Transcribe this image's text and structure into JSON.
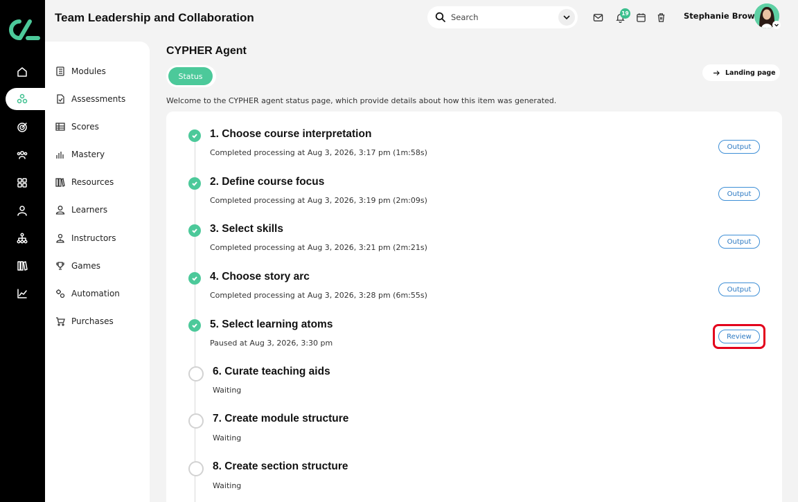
{
  "header": {
    "title": "Team Leadership and Collaboration",
    "search_placeholder": "Search",
    "notification_count": "19",
    "user_name": "Stephanie Brown"
  },
  "rail": {
    "icons": [
      "home-icon",
      "network-icon",
      "target-icon",
      "users-icon",
      "grid-icon",
      "person-icon",
      "org-chart-icon",
      "library-icon",
      "chart-line-icon"
    ]
  },
  "sidebar": {
    "items": [
      {
        "label": "Modules",
        "icon": "modules-icon"
      },
      {
        "label": "Assessments",
        "icon": "assessment-icon"
      },
      {
        "label": "Scores",
        "icon": "table-icon"
      },
      {
        "label": "Mastery",
        "icon": "bar-chart-icon"
      },
      {
        "label": "Resources",
        "icon": "books-icon"
      },
      {
        "label": "Learners",
        "icon": "user-icon"
      },
      {
        "label": "Instructors",
        "icon": "instructor-icon"
      },
      {
        "label": "Games",
        "icon": "trophy-icon"
      },
      {
        "label": "Automation",
        "icon": "gears-icon"
      },
      {
        "label": "Purchases",
        "icon": "cart-icon"
      }
    ]
  },
  "page": {
    "title": "CYPHER Agent",
    "tab_status": "Status",
    "landing_button": "Landing page",
    "welcome": "Welcome to the CYPHER agent status page, which provide details about how this item was generated."
  },
  "steps": [
    {
      "title": "1. Choose course interpretation",
      "status": "Completed processing at Aug 3, 2026, 3:17 pm (1m:58s)",
      "state": "done",
      "action": "Output"
    },
    {
      "title": "2. Define course focus",
      "status": "Completed processing at Aug 3, 2026, 3:19 pm (2m:09s)",
      "state": "done",
      "action": "Output"
    },
    {
      "title": "3. Select skills",
      "status": "Completed processing at Aug 3, 2026, 3:21 pm (2m:21s)",
      "state": "done",
      "action": "Output"
    },
    {
      "title": "4. Choose story arc",
      "status": "Completed processing at Aug 3, 2026, 3:28 pm (6m:55s)",
      "state": "done",
      "action": "Output"
    },
    {
      "title": "5. Select learning atoms",
      "status": "Paused at Aug 3, 2026, 3:30 pm",
      "state": "paused",
      "action": "Review"
    },
    {
      "title": "6. Curate teaching aids",
      "status": "Waiting",
      "state": "waiting"
    },
    {
      "title": "7. Create module structure",
      "status": "Waiting",
      "state": "waiting"
    },
    {
      "title": "8. Create section structure",
      "status": "Waiting",
      "state": "waiting"
    }
  ],
  "colors": {
    "accent": "#4cc99a",
    "button_blue": "#2a78c2",
    "highlight_red": "#e3001b"
  }
}
